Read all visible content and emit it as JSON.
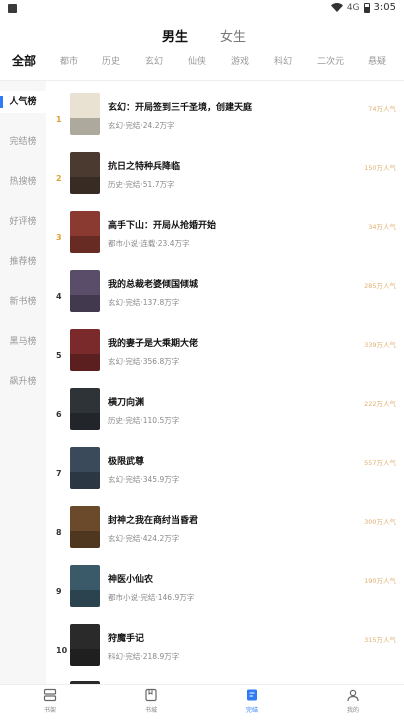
{
  "status_bar": {
    "time": "3:05",
    "signal_text": "4G"
  },
  "gender_tabs": [
    {
      "label": "男生",
      "active": true
    },
    {
      "label": "女生",
      "active": false
    }
  ],
  "categories": [
    {
      "label": "全部",
      "active": true
    },
    {
      "label": "都市",
      "active": false
    },
    {
      "label": "历史",
      "active": false
    },
    {
      "label": "玄幻",
      "active": false
    },
    {
      "label": "仙侠",
      "active": false
    },
    {
      "label": "游戏",
      "active": false
    },
    {
      "label": "科幻",
      "active": false
    },
    {
      "label": "二次元",
      "active": false
    },
    {
      "label": "悬疑",
      "active": false
    }
  ],
  "sidebar": [
    {
      "label": "人气榜",
      "active": true
    },
    {
      "label": "完结榜",
      "active": false
    },
    {
      "label": "热搜榜",
      "active": false
    },
    {
      "label": "好评榜",
      "active": false
    },
    {
      "label": "推荐榜",
      "active": false
    },
    {
      "label": "新书榜",
      "active": false
    },
    {
      "label": "黑马榜",
      "active": false
    },
    {
      "label": "飙升榜",
      "active": false
    }
  ],
  "books": [
    {
      "rank": "1",
      "title": "玄幻：开局签到三千圣境，创建天庭",
      "meta": "玄幻·完结·24.2万字",
      "popularity": "74万人气",
      "cover_color": "#e9e2d2"
    },
    {
      "rank": "2",
      "title": "抗日之特种兵降临",
      "meta": "历史·完结·51.7万字",
      "popularity": "150万人气",
      "cover_color": "#4a3a30"
    },
    {
      "rank": "3",
      "title": "高手下山：开局从抢婚开始",
      "meta": "都市小说·连载·23.4万字",
      "popularity": "34万人气",
      "cover_color": "#8a3a30"
    },
    {
      "rank": "4",
      "title": "我的总裁老婆倾国倾城",
      "meta": "玄幻·完结·137.8万字",
      "popularity": "285万人气",
      "cover_color": "#5a4d6a"
    },
    {
      "rank": "5",
      "title": "我的妻子是大乘期大佬",
      "meta": "玄幻·完结·356.8万字",
      "popularity": "339万人气",
      "cover_color": "#7a2a2a"
    },
    {
      "rank": "6",
      "title": "横刀向渊",
      "meta": "历史·完结·110.5万字",
      "popularity": "222万人气",
      "cover_color": "#2e3338"
    },
    {
      "rank": "7",
      "title": "极限武尊",
      "meta": "玄幻·完结·345.9万字",
      "popularity": "557万人气",
      "cover_color": "#3a4a5a"
    },
    {
      "rank": "8",
      "title": "封神之我在商纣当昏君",
      "meta": "玄幻·完结·424.2万字",
      "popularity": "300万人气",
      "cover_color": "#6a4a2a"
    },
    {
      "rank": "9",
      "title": "神医小仙农",
      "meta": "都市小说·完结·146.9万字",
      "popularity": "190万人气",
      "cover_color": "#3a5a6a"
    },
    {
      "rank": "10",
      "title": "狩魔手记",
      "meta": "科幻·完结·218.9万字",
      "popularity": "315万人气",
      "cover_color": "#2a2a2a"
    }
  ],
  "bottom_nav": [
    {
      "label": "书架",
      "icon": "bookshelf-icon",
      "active": false
    },
    {
      "label": "书城",
      "icon": "bookstore-icon",
      "active": false
    },
    {
      "label": "完结",
      "icon": "finished-icon",
      "active": true
    },
    {
      "label": "我的",
      "icon": "profile-icon",
      "active": false
    }
  ],
  "colors": {
    "accent": "#2f7cf6",
    "rank_top": "#e0a030",
    "popularity": "#e0b070"
  }
}
